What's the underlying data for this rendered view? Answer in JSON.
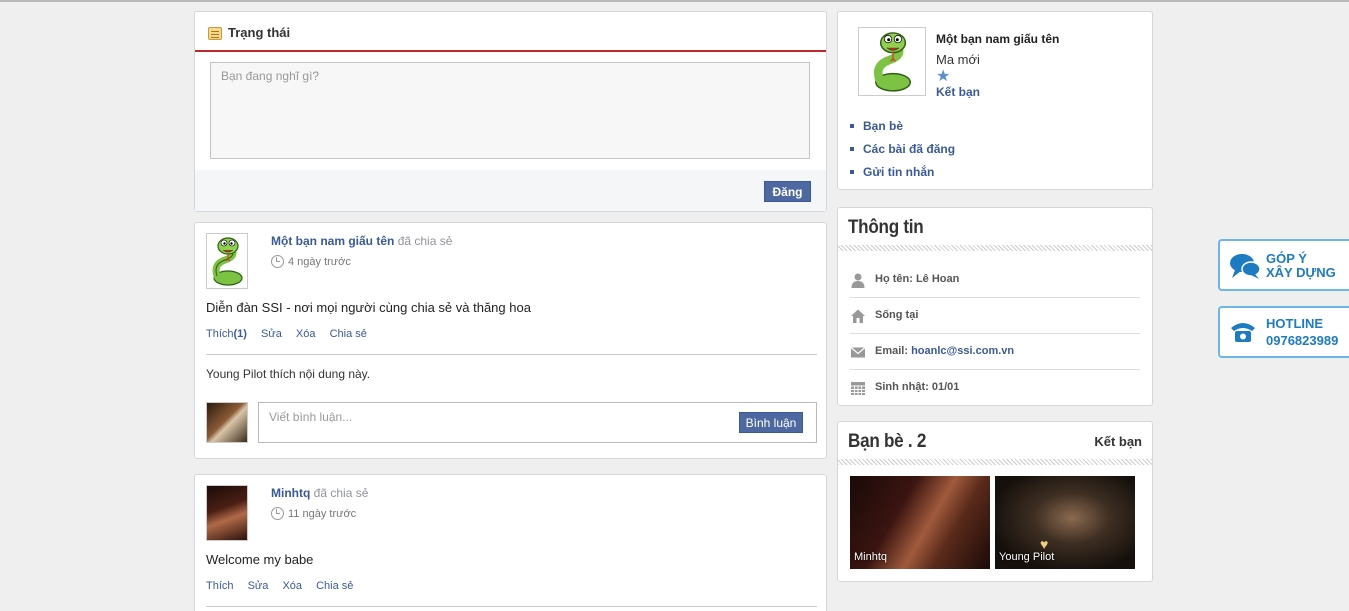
{
  "status": {
    "title": "Trạng thái",
    "placeholder": "Bạn đang nghĩ gì?",
    "post_button": "Đăng"
  },
  "posts": [
    {
      "author": "Một bạn nam giấu tên",
      "shared": "đã chia sẻ",
      "time": "4 ngày trước",
      "body": "Diễn đàn SSI - nơi mọi người cùng chia sẻ và thăng hoa",
      "actions": {
        "like": "Thích",
        "like_count": "(1)",
        "edit": "Sửa",
        "delete": "Xóa",
        "share": "Chia sẻ"
      },
      "likes_text": "Young Pilot thích nội dung này.",
      "comment_placeholder": "Viết bình luận...",
      "comment_button": "Bình luận"
    },
    {
      "author": "Minhtq",
      "shared": "đã chia sẻ",
      "time": "11 ngày trước",
      "body": "Welcome my babe",
      "actions": {
        "like": "Thích",
        "edit": "Sửa",
        "delete": "Xóa",
        "share": "Chia sẻ"
      }
    }
  ],
  "profile": {
    "name": "Một bạn nam giấu tên",
    "rank": "Ma mới",
    "friend_link": "Kết bạn",
    "links": [
      "Bạn bè",
      "Các bài đã đăng",
      "Gửi tin nhắn"
    ]
  },
  "info": {
    "title": "Thông tin",
    "rows": [
      {
        "icon": "person-icon",
        "label": "Họ tên:",
        "value": "Lê Hoan"
      },
      {
        "icon": "home-icon",
        "label": "Sống tại",
        "value": ""
      },
      {
        "icon": "mail-icon",
        "label": "Email:",
        "value": "hoanlc@ssi.com.vn"
      },
      {
        "icon": "calendar-icon",
        "label": "Sinh nhật:",
        "value": "01/01"
      }
    ]
  },
  "friends": {
    "title": "Bạn bè . 2",
    "add_label": "Kết bạn",
    "items": [
      {
        "name": "Minhtq"
      },
      {
        "name": "Young Pilot"
      }
    ]
  },
  "widgets": {
    "feedback_line1": "GÓP Ý",
    "feedback_line2": "XÂY DỰNG",
    "hotline_label": "HOTLINE",
    "hotline_number": "0976823989"
  },
  "colors": {
    "accent": "#3b5998",
    "status_border": "#c0272d",
    "widget": "#1d7bc4"
  }
}
